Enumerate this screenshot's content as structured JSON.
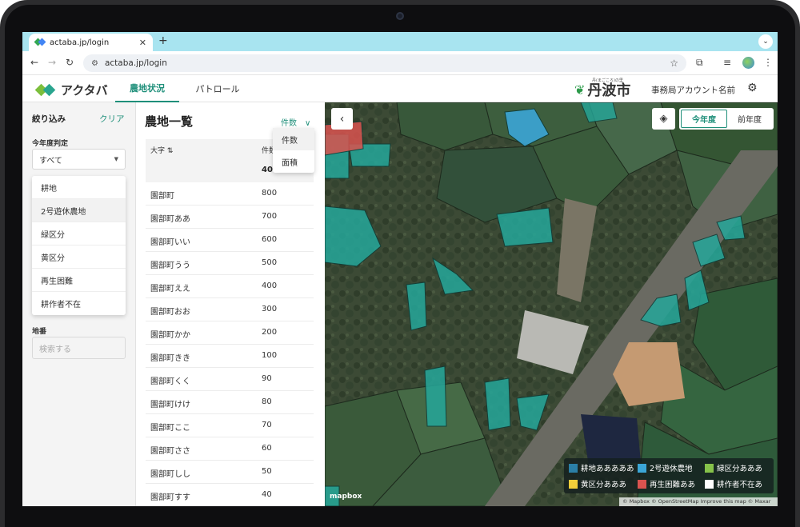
{
  "browser": {
    "tab_title": "actaba.jp/login",
    "tab_close": "✕",
    "new_tab": "+",
    "tab_menu": "⌄",
    "url": "actaba.jp/login",
    "back": "←",
    "forward": "→",
    "reload": "↻",
    "site_icon": "⚙",
    "star": "☆",
    "extensions": "⧉",
    "media": "≡",
    "menu": "⋮"
  },
  "header": {
    "logo_text": "アクタバ",
    "tabs": [
      {
        "label": "農地状況",
        "active": true
      },
      {
        "label": "パトロール",
        "active": false
      }
    ],
    "city_subtitle": "丹(まごころ)の里",
    "city_name": "丹波市",
    "city_leaf": "❦",
    "account_name": "事務局アカウント名前",
    "settings_icon": "⚙"
  },
  "filter": {
    "title": "絞り込み",
    "clear_label": "クリア",
    "judgement_label": "今年度判定",
    "judgement_value": "すべて",
    "judgement_caret": "▼",
    "options": [
      "耕地",
      "2号遊休農地",
      "緑区分",
      "黄区分",
      "再生困難",
      "耕作者不在"
    ],
    "chiban_label": "地番",
    "search_placeholder": "検索する"
  },
  "list": {
    "title": "農地一覧",
    "sort_label": "件数",
    "sort_chevron": "∨",
    "sort_options": [
      "件数",
      "面積"
    ],
    "col_name": "大字 ⇅",
    "col_count": "件数",
    "subtotal": "40",
    "rows": [
      {
        "name": "園部町",
        "count": "800"
      },
      {
        "name": "園部町ああ",
        "count": "700"
      },
      {
        "name": "園部町いい",
        "count": "600"
      },
      {
        "name": "園部町うう",
        "count": "500"
      },
      {
        "name": "園部町ええ",
        "count": "400"
      },
      {
        "name": "園部町おお",
        "count": "300"
      },
      {
        "name": "園部町かか",
        "count": "200"
      },
      {
        "name": "園部町きき",
        "count": "100"
      },
      {
        "name": "園部町くく",
        "count": "90"
      },
      {
        "name": "園部町けけ",
        "count": "80"
      },
      {
        "name": "園部町ここ",
        "count": "70"
      },
      {
        "name": "園部町ささ",
        "count": "60"
      },
      {
        "name": "園部町しし",
        "count": "50"
      },
      {
        "name": "園部町すす",
        "count": "40"
      }
    ]
  },
  "map": {
    "back_icon": "‹",
    "layers_icon": "◈",
    "this_year": "今年度",
    "last_year": "前年度",
    "legend": [
      {
        "label": "耕地あああああ",
        "color": "#2b7fa6"
      },
      {
        "label": "2号遊休農地",
        "color": "#3ba6d6"
      },
      {
        "label": "緑区分あああ",
        "color": "#86c24a"
      },
      {
        "label": "黄区分あああ",
        "color": "#f2cf3a"
      },
      {
        "label": "再生困難ああ",
        "color": "#d9534f"
      },
      {
        "label": "耕作者不在あ",
        "color": "#ffffff"
      }
    ],
    "mapbox_logo": "mapbox",
    "attribution": "© Mapbox © OpenStreetMap Improve this map © Maxar"
  }
}
